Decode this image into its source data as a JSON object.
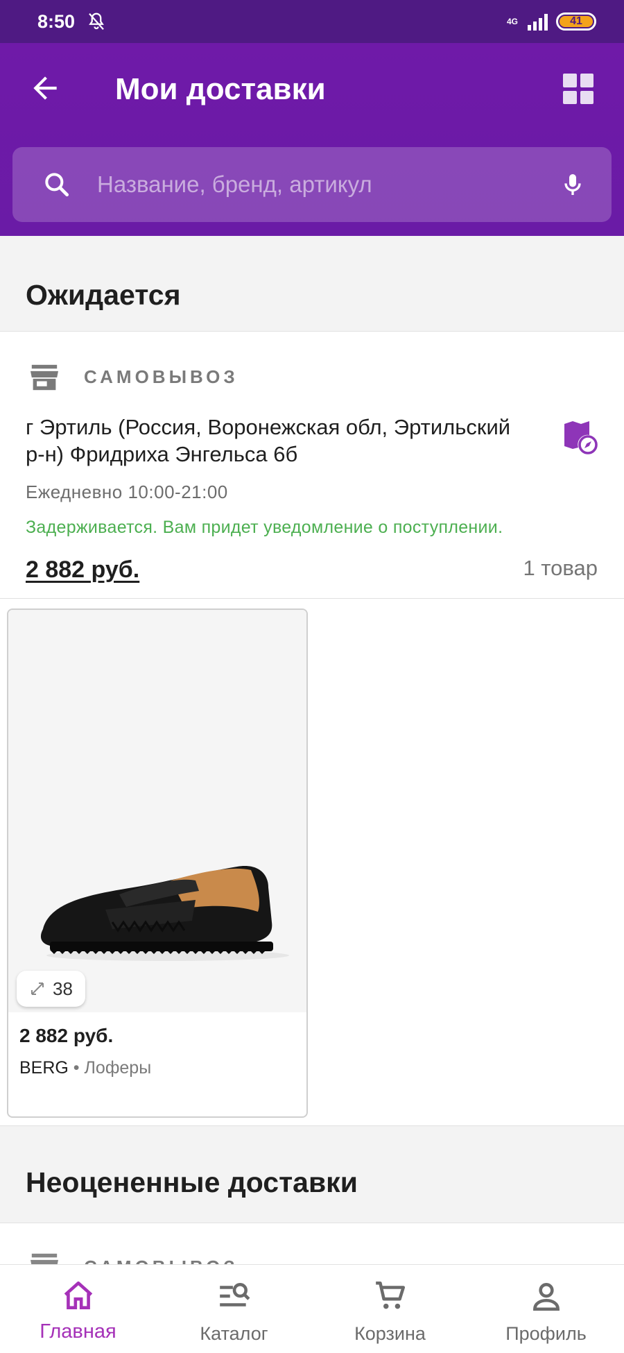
{
  "status_bar": {
    "time": "8:50",
    "network": "4G",
    "battery": "41"
  },
  "app_bar": {
    "title": "Мои доставки"
  },
  "search": {
    "placeholder": "Название, бренд, артикул"
  },
  "sections": {
    "expected": "Ожидается",
    "unrated": "Неоцененные доставки"
  },
  "delivery": {
    "method": "САМОВЫВОЗ",
    "address": "г Эртиль (Россия, Воронежская обл, Эртильский р-н) Фридриха Энгельса 6б",
    "hours": "Ежедневно 10:00-21:00",
    "status": "Задерживается. Вам придет уведомление о поступлении.",
    "total": "2 882 руб.",
    "items_count": "1 товар"
  },
  "product": {
    "size": "38",
    "price": "2 882 руб.",
    "brand": "BERG",
    "separator": " • ",
    "category": "Лоферы"
  },
  "second_delivery": {
    "method": "САМОВЫВОЗ"
  },
  "bottom_nav": {
    "items": [
      {
        "label": "Главная",
        "icon": "home-icon",
        "active": true
      },
      {
        "label": "Каталог",
        "icon": "catalog-icon",
        "active": false
      },
      {
        "label": "Корзина",
        "icon": "cart-icon",
        "active": false
      },
      {
        "label": "Профиль",
        "icon": "profile-icon",
        "active": false
      }
    ]
  },
  "colors": {
    "primary": "#6f1aa8",
    "status_bar": "#4f1a83",
    "accent_active": "#a531b8",
    "status_ok": "#4caf50"
  }
}
